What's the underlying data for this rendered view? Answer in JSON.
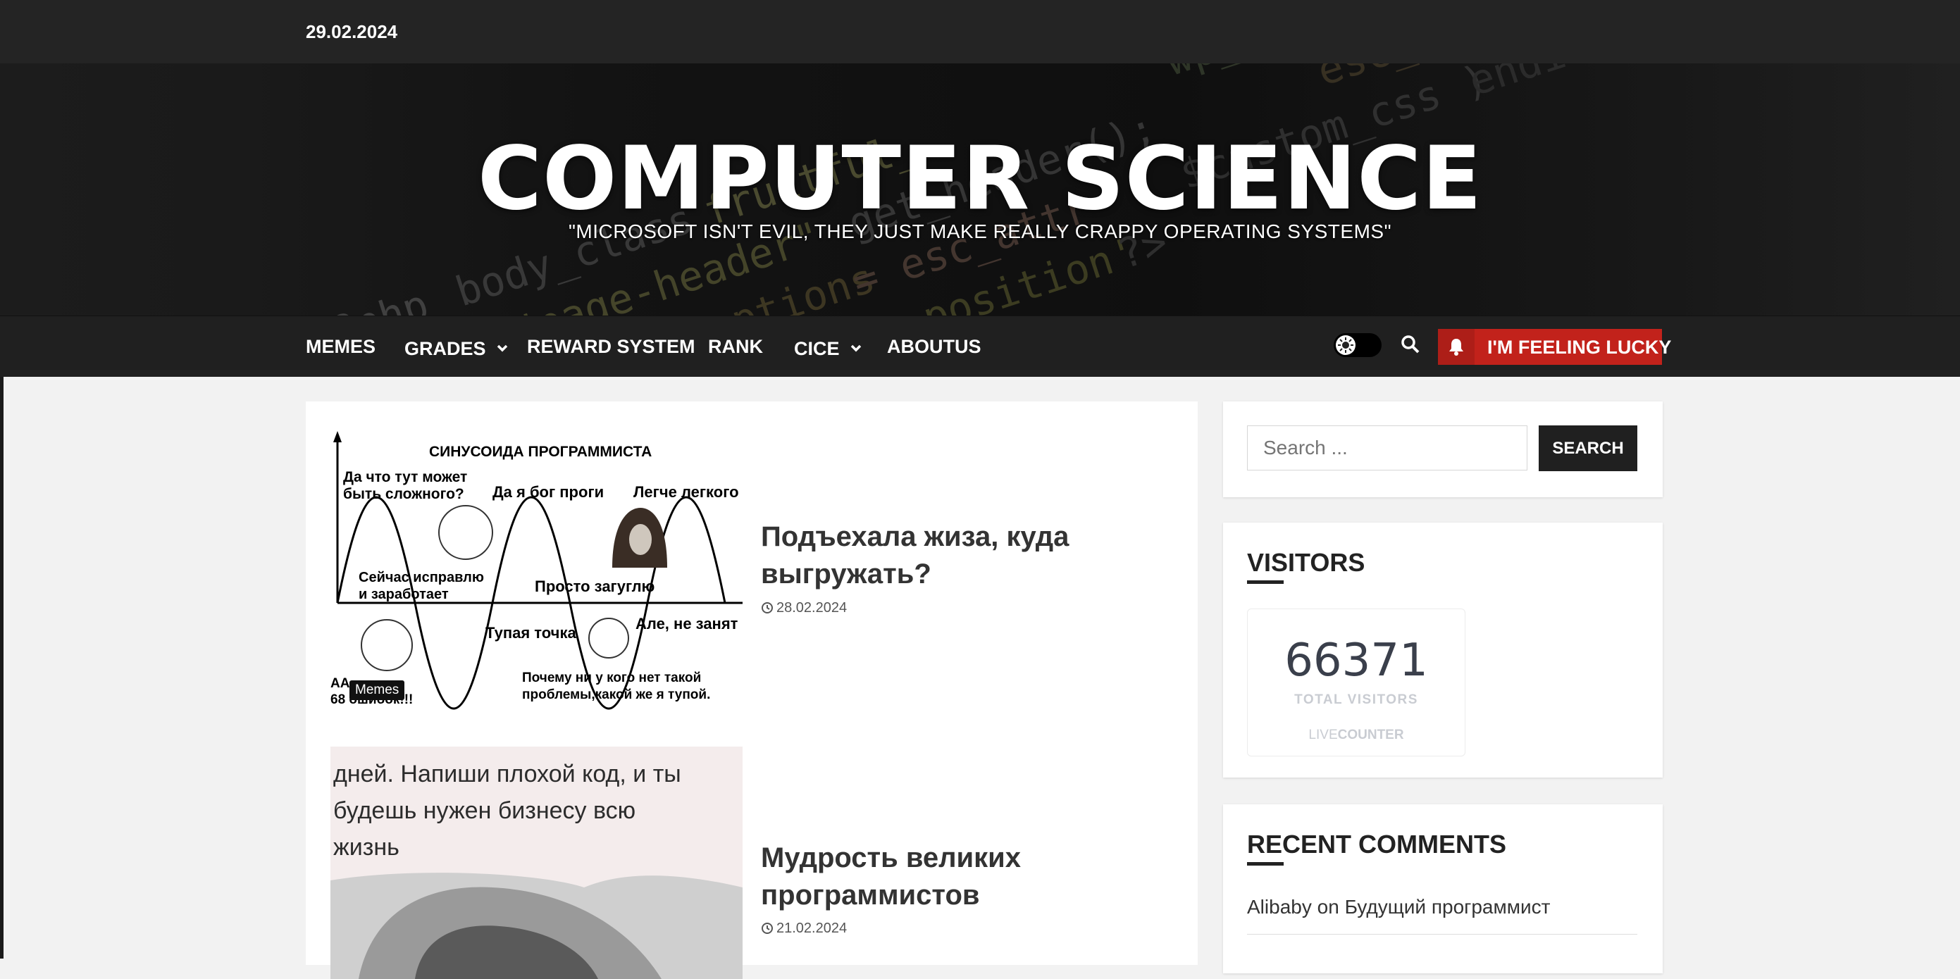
{
  "topbar": {
    "date": "29.02.2024"
  },
  "header": {
    "title": "COMPUTER SCIENCE",
    "tagline": "\"MICROSOFT ISN'T EVIL, THEY JUST MAKE REALLY CRAPPY OPERATING SYSTEMS\""
  },
  "nav": {
    "items": [
      {
        "label": "MEMES",
        "has_dropdown": false
      },
      {
        "label": "GRADES",
        "has_dropdown": true
      },
      {
        "label": "REWARD SYSTEM",
        "has_dropdown": false
      },
      {
        "label": "RANK",
        "has_dropdown": false
      },
      {
        "label": "CICE",
        "has_dropdown": true
      },
      {
        "label": "ABOUTUS",
        "has_dropdown": false
      }
    ],
    "lucky_label": "I'M FEELING LUCKY",
    "icons": [
      "sun-icon",
      "search-icon",
      "bell-icon"
    ]
  },
  "posts": [
    {
      "title": "Подъехала жиза, куда выгружать?",
      "date": "28.02.2024",
      "category": "Memes",
      "meme": {
        "heading": "СИНУСОИДА ПРОГРАММИСТА",
        "captions": [
          "Да что тут может",
          "быть сложного?",
          "Да я бог проги",
          "Легче легкого",
          "Сейчас  исправлю",
          "и заработает",
          "Просто загуглю",
          "Тупая точка",
          "Але, не занят",
          "Почему ни у кого нет такой",
          "проблемы,какой же я тупой.",
          "АА",
          "68 ошибок!!!"
        ]
      }
    },
    {
      "title": "Мудрость великих программистов",
      "date": "21.02.2024",
      "image_text": [
        "дней. Напиши плохой код, и ты",
        "будешь нужен бизнесу всю",
        "жизнь"
      ]
    }
  ],
  "sidebar": {
    "search": {
      "placeholder": "Search ...",
      "button": "SEARCH"
    },
    "visitors": {
      "title": "VISITORS",
      "count": "66371",
      "label": "TOTAL VISITORS",
      "brand_live": "LIVE",
      "brand_counter": "COUNTER"
    },
    "comments": {
      "title": "RECENT COMMENTS",
      "items": [
        {
          "author": "Alibaby",
          "on": "on",
          "post": "Будущий программист"
        }
      ]
    }
  },
  "colors": {
    "accent_red": "#c2221b",
    "dark": "#202020"
  }
}
